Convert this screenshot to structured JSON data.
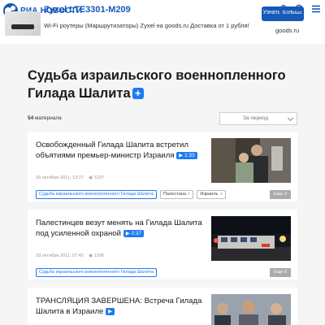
{
  "header": {
    "logo_text": "РИА НОВОСТИ",
    "ad": {
      "title": "Zyxel LTE3301-M209",
      "description": "Wi-Fi роутеры (Маршрутизаторы) Zyxel на goods.ru Доставка от 1 рубля!",
      "button_label": "Узнать больше",
      "domain": "goods.ru"
    },
    "icons": [
      "person-icon",
      "search-icon",
      "menu-icon"
    ]
  },
  "page": {
    "title": "Судьба израильского военнопленного Гилада Шалита",
    "title_badge": "+"
  },
  "filter": {
    "count_number": "54",
    "count_label": "материала",
    "period_label": "За период"
  },
  "articles": [
    {
      "title": "Освобожденный Гилада Шалита встретил объятиями премьер-министр Израиля",
      "video_duration": "1:33",
      "date": "18 октября 2011, 13:27",
      "views": "3107",
      "tags": [
        "Судьба израильского военнопленного Гилада Шалита",
        "Палестина",
        "Израиль"
      ],
      "more": "Еще 3"
    },
    {
      "title": "Палестинцев везут менять на Гилада Шалита под усиленной охраной",
      "video_duration": "0:37",
      "date": "18 октября 2011, 07:42",
      "views": "1206",
      "tags": [
        "Судьба израильского военнопленного Гилада Шалита"
      ],
      "more": "Еще 6"
    },
    {
      "title": "ТРАНСЛЯЦИЯ ЗАВЕРШЕНА: Встреча Гилада Шалита в Израиле",
      "video_duration": ""
    }
  ],
  "colors": {
    "brand": "#1659b8",
    "accent": "#1e7af0",
    "background": "#f5f5f5"
  }
}
